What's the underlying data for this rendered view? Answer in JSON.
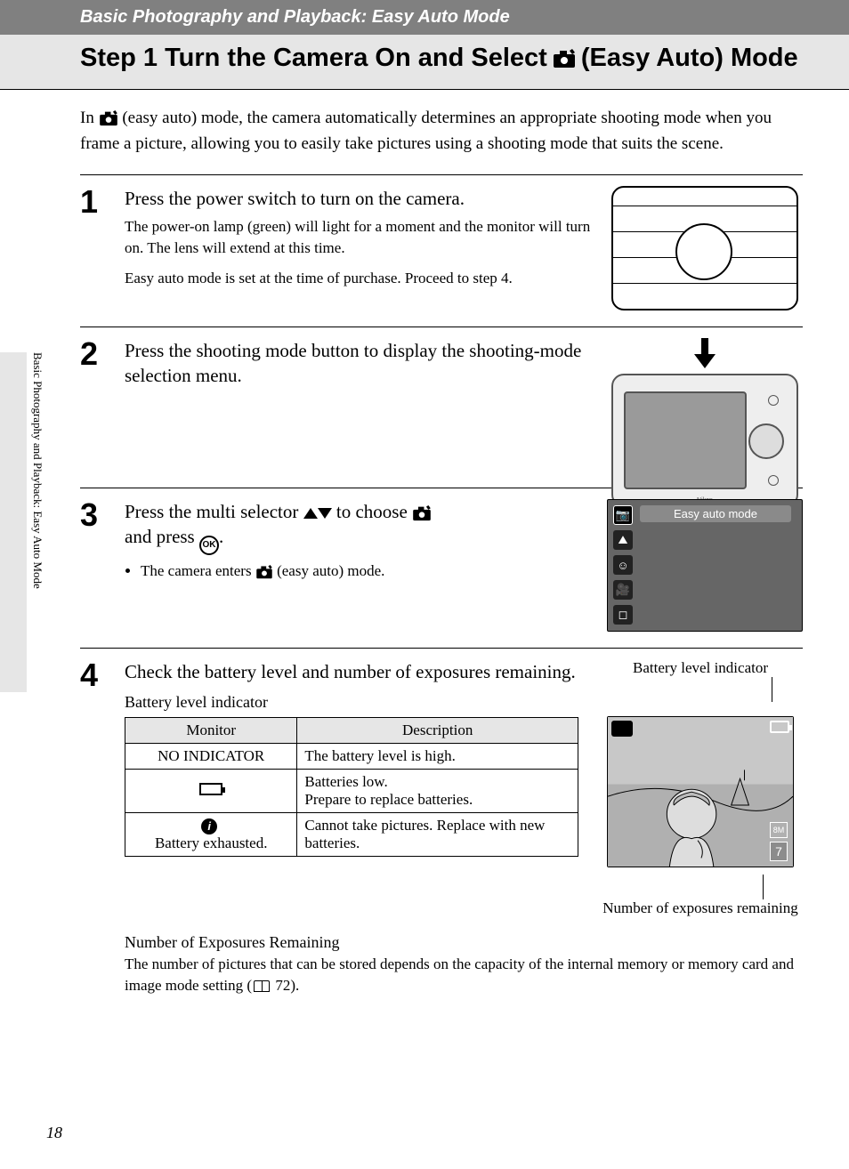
{
  "topbar": "Basic Photography and Playback: Easy Auto Mode",
  "title_pre": "Step 1 Turn the Camera On and Select",
  "title_post": "(Easy Auto) Mode",
  "side_label": "Basic Photography and Playback: Easy Auto Mode",
  "page_number": "18",
  "intro": {
    "pre": "In",
    "mid": "(easy auto) mode, the camera automatically determines an appropriate shooting mode when you frame a picture, allowing you to easily take pictures using a shooting mode that suits the scene."
  },
  "steps": {
    "s1": {
      "num": "1",
      "head": "Press the power switch to turn on the camera.",
      "p1": "The power-on lamp (green) will light for a moment and the monitor will turn on. The lens will extend at this time.",
      "p2": "Easy auto mode is set at the time of purchase. Proceed to step 4."
    },
    "s2": {
      "num": "2",
      "head": "Press the shooting mode button to display the shooting-mode selection menu.",
      "brand": "Nikon"
    },
    "s3": {
      "num": "3",
      "head_pre": "Press the multi selector",
      "head_mid": "to choose",
      "head_post": "and press",
      "bullet_pre": "The camera enters",
      "bullet_post": "(easy auto) mode.",
      "lcd_label": "Easy auto mode",
      "ok": "OK"
    },
    "s4": {
      "num": "4",
      "head": "Check the battery level and number of exposures remaining.",
      "sub_h": "Battery level indicator",
      "fig_top": "Battery level indicator",
      "fig_num": "7",
      "fig_sz": "8M",
      "fig_bottom": "Number of exposures remaining"
    }
  },
  "table": {
    "h1": "Monitor",
    "h2": "Description",
    "r1_m": "NO INDICATOR",
    "r1_d": "The battery level is high.",
    "r2_d": "Batteries low.\nPrepare to replace batteries.",
    "r3_m": "Battery exhausted.",
    "r3_d": "Cannot take pictures. Replace with new batteries."
  },
  "numexp": {
    "h": "Number of Exposures Remaining",
    "p_pre": "The number of pictures that can be stored depends on the capacity of the internal memory or memory card and image mode setting (",
    "p_post": " 72)."
  }
}
